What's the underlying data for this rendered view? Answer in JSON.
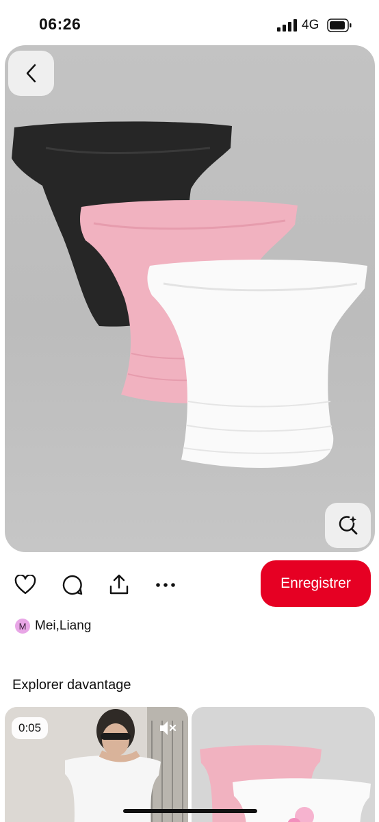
{
  "status_bar": {
    "time": "06:26",
    "network": "4G"
  },
  "pin": {
    "image": {
      "subject": "three off-shoulder tops",
      "colors": [
        "#2a2a2a",
        "#f1b2c0",
        "#f9f9f9"
      ]
    },
    "author": {
      "initial": "M",
      "name": "Mei,Liang"
    }
  },
  "actions": {
    "save_label": "Enregistrer"
  },
  "explore": {
    "title": "Explorer davantage",
    "cards": [
      {
        "duration": "0:05"
      }
    ]
  },
  "colors": {
    "accent": "#e60023",
    "avatar": "#e8a6e6"
  }
}
